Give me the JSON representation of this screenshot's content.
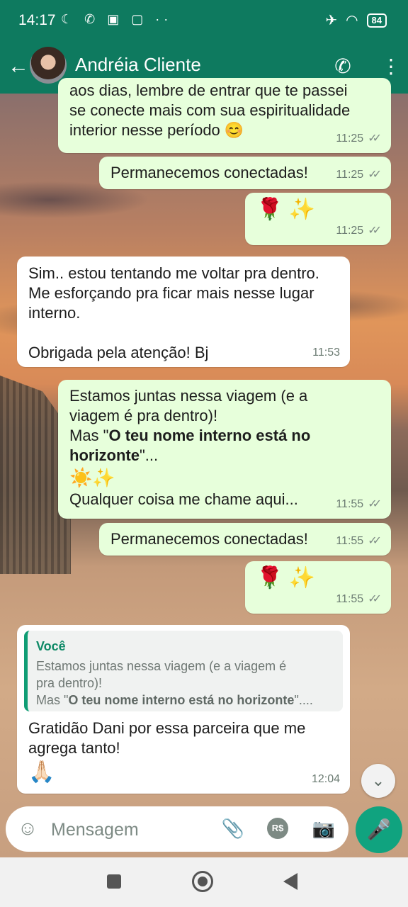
{
  "status_bar": {
    "time": "14:17",
    "battery": "84"
  },
  "header": {
    "contact_name": "Andréia Cliente"
  },
  "messages": [
    {
      "dir": "out",
      "lines": [
        "se conecte mais com sua espiritualidade",
        "interior nesse período 😊"
      ],
      "time": "11:25",
      "partial_top": "aos dias, lembre de entrar que te passei"
    },
    {
      "dir": "out",
      "text": "Permanecemos conectadas!",
      "time": "11:25"
    },
    {
      "dir": "out",
      "emoji": "🌹 ✨",
      "time": "11:25"
    },
    {
      "dir": "in",
      "lines": [
        "Sim.. estou tentando me voltar pra dentro.",
        "Me esforçando pra ficar mais nesse lugar",
        "interno.",
        "",
        "Obrigada pela atenção! Bj"
      ],
      "time": "11:53"
    },
    {
      "dir": "out",
      "line1": "Estamos juntas nessa viagem (e a",
      "line2": "viagem é pra dentro)!",
      "line3_prefix": "Mas \"",
      "line3_bold": "O teu nome interno está no",
      "line4_bold": "horizonte",
      "line4_suffix": "\"...",
      "emoji": "☀️✨",
      "line_last": "Qualquer coisa me chame aqui...",
      "time": "11:55"
    },
    {
      "dir": "out",
      "text": "Permanecemos conectadas!",
      "time": "11:55"
    },
    {
      "dir": "out",
      "emoji": "🌹 ✨",
      "time": "11:55"
    },
    {
      "dir": "in",
      "quote": {
        "author": "Você",
        "line1": "Estamos juntas nessa viagem (e a viagem é",
        "line2": "pra dentro)!",
        "line3_prefix": "Mas \"",
        "line3_bold": "O teu nome interno está no horizonte",
        "line3_suffix": "\"...."
      },
      "lines": [
        "Gratidão Dani por essa parceira que me",
        "agrega tanto!"
      ],
      "emoji": "🙏🏻",
      "time": "12:04"
    }
  ],
  "input": {
    "placeholder": "Mensagem",
    "pay_label": "R$"
  },
  "colors": {
    "header": "#0e7a5f",
    "outgoing": "#e7ffdb",
    "incoming": "#ffffff",
    "accent": "#10a37f"
  }
}
